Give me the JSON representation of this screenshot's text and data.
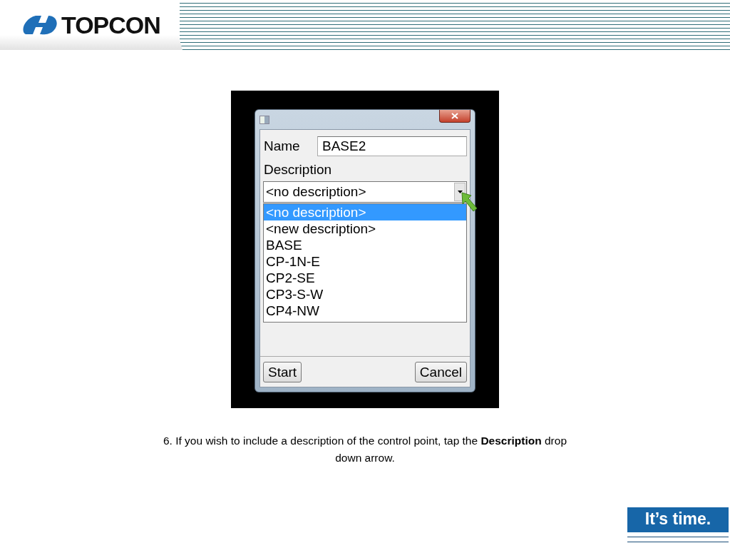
{
  "header": {
    "logo": "TOPCON"
  },
  "dialog": {
    "name_label": "Name",
    "name_value": "BASE2",
    "description_label": "Description",
    "description_value": "<no description>",
    "options": [
      {
        "label": "<no description>",
        "selected": true
      },
      {
        "label": "<new description>",
        "selected": false
      },
      {
        "label": "BASE",
        "selected": false
      },
      {
        "label": "CP-1N-E",
        "selected": false
      },
      {
        "label": "CP2-SE",
        "selected": false
      },
      {
        "label": "CP3-S-W",
        "selected": false
      },
      {
        "label": "CP4-NW",
        "selected": false
      }
    ],
    "buttons": [
      "Start",
      "Cancel"
    ]
  },
  "caption": "6. If you wish to include a description of the control point, tap the **Description** drop down arrow.",
  "tagline": "It’s time."
}
